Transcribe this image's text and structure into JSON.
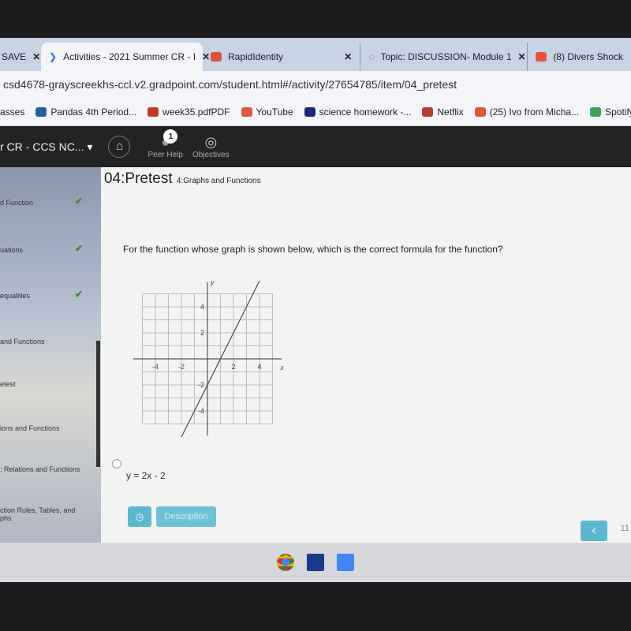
{
  "browser": {
    "tabs": [
      {
        "label": "SAVE",
        "active": false
      },
      {
        "label": "Activities - 2021 Summer CR - I",
        "active": true
      },
      {
        "label": "RapidIdentity",
        "active": false
      },
      {
        "label": "Topic: DISCUSSION- Module 1",
        "active": false
      },
      {
        "label": "(8) Divers Shock",
        "active": false
      }
    ],
    "url": "csd4678-grayscreekhs-ccl.v2.gradpoint.com/student.html#/activity/27654785/item/04_pretest",
    "bookmarks": [
      {
        "label": "asses",
        "icon": ""
      },
      {
        "label": "Pandas 4th Period...",
        "icon": "person-icon",
        "color": "#2a5d9f"
      },
      {
        "label": "week35.pdfPDF",
        "icon": "pdf-icon",
        "color": "#c0392b"
      },
      {
        "label": "YouTube",
        "icon": "youtube-icon",
        "color": "#e5533d"
      },
      {
        "label": "science homework -...",
        "icon": "shield-icon",
        "color": "#1a2a7a"
      },
      {
        "label": "Netflix",
        "icon": "netflix-icon",
        "color": "#c0392b"
      },
      {
        "label": "(25) Ivo from Micha...",
        "icon": "youtube-icon",
        "color": "#e5533d"
      },
      {
        "label": "Spotify -",
        "icon": "spotify-icon",
        "color": "#3aa55a"
      }
    ]
  },
  "nav": {
    "course": "r CR - CCS NC...",
    "peer_help": "Peer Help",
    "objectives": "Objectives",
    "badge": "1"
  },
  "sidebar": {
    "items": [
      {
        "label": "d Function",
        "done": true
      },
      {
        "label": "uations",
        "done": true
      },
      {
        "label": "equalities",
        "done": true
      },
      {
        "label": "and Functions",
        "done": false
      },
      {
        "label": "etest",
        "done": false
      },
      {
        "label": "ions and Functions",
        "done": false
      },
      {
        "label": ": Relations and Functions",
        "done": false
      },
      {
        "label": "ction Rules, Tables, and",
        "label2": "phs",
        "done": false
      }
    ]
  },
  "main": {
    "title": "04:Pretest",
    "subtitle": "4:Graphs and Functions",
    "question": "For the function whose graph is shown below, which is the correct formula for the function?",
    "answer": "y = 2x - 2",
    "description_button": "Description",
    "page": "11"
  },
  "graph": {
    "xlabel": "x",
    "ylabel": "y",
    "xticks": [
      "-4",
      "-2",
      "2",
      "4"
    ],
    "yticks": [
      "4",
      "2",
      "-2",
      "-4"
    ],
    "xlim": [
      -5,
      5
    ],
    "ylim": [
      -5,
      5
    ],
    "slope": 2,
    "intercept": -2
  }
}
